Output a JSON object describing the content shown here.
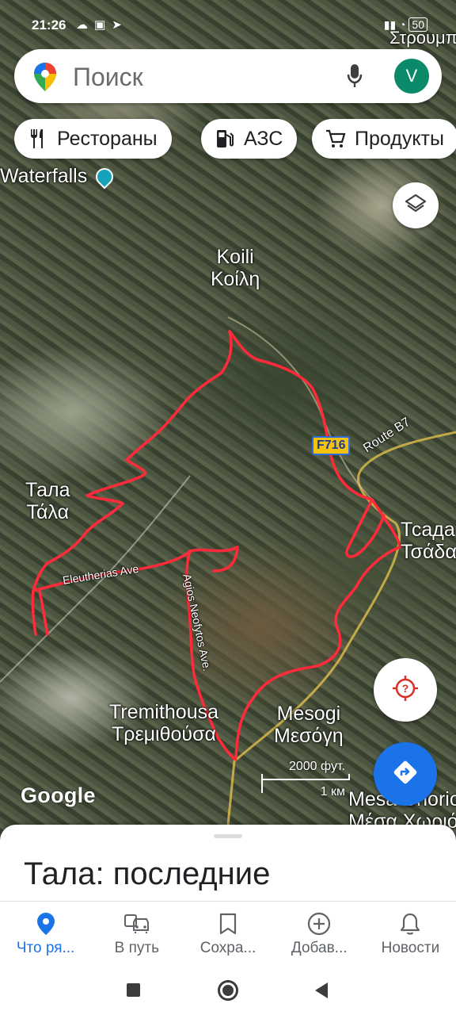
{
  "status_bar": {
    "time": "21:26",
    "left_icons": [
      "cloud-icon",
      "sim-icon",
      "telegram-icon"
    ],
    "right_icons": [
      "signal-icon",
      "wifi-icon",
      "battery-icon"
    ],
    "battery_text": "50"
  },
  "search": {
    "placeholder": "Поиск",
    "avatar_letter": "V"
  },
  "chips": [
    {
      "label": "Рестораны",
      "icon": "restaurant-icon"
    },
    {
      "label": "АЗС",
      "icon": "gas-station-icon"
    },
    {
      "label": "Продукты",
      "icon": "cart-icon"
    }
  ],
  "map": {
    "places": [
      {
        "id": "waterfalls",
        "text": "Waterfalls"
      },
      {
        "id": "koili_latin",
        "text": "Koili"
      },
      {
        "id": "koili_greek",
        "text": "Κοίλη"
      },
      {
        "id": "tala_ru",
        "text": "Тала"
      },
      {
        "id": "tala_greek",
        "text": "Τάλα"
      },
      {
        "id": "tsada_latin",
        "text": "Тсада"
      },
      {
        "id": "tsada_greek",
        "text": "Τσάδα"
      },
      {
        "id": "tremithousa_latin",
        "text": "Tremithousa"
      },
      {
        "id": "tremithousa_greek",
        "text": "Τρεμιθούσα"
      },
      {
        "id": "mesogi_latin",
        "text": "Mesogi"
      },
      {
        "id": "mesogi_greek",
        "text": "Μεσόγη"
      },
      {
        "id": "mesa_chorio_latin",
        "text": "Mesa Chorio"
      },
      {
        "id": "mesa_chorio_greek",
        "text": "Μέσα Χωριό"
      },
      {
        "id": "strumbi",
        "text": "Στρουμπί"
      }
    ],
    "roads": {
      "route_b7": "Route B7",
      "eleutherias": "Eleutherias Ave",
      "agios_neofytos": "Agios Neofytos Ave.",
      "f716": "F716"
    },
    "scale_imperial": "2000 фут.",
    "scale_metric": "1 км",
    "logo": "Google",
    "route_color": "#ff2a3a"
  },
  "sheet": {
    "title": "Тала: последние"
  },
  "bottom_nav": [
    {
      "label": "Что ря...",
      "icon": "explore-pin-icon",
      "active": true
    },
    {
      "label": "В путь",
      "icon": "commute-car-icon",
      "active": false
    },
    {
      "label": "Сохра...",
      "icon": "bookmark-icon",
      "active": false
    },
    {
      "label": "Добав...",
      "icon": "add-circle-icon",
      "active": false
    },
    {
      "label": "Новости",
      "icon": "bell-icon",
      "active": false
    }
  ],
  "colors": {
    "accent": "#1a73e8",
    "avatar": "#0b8a6b"
  }
}
